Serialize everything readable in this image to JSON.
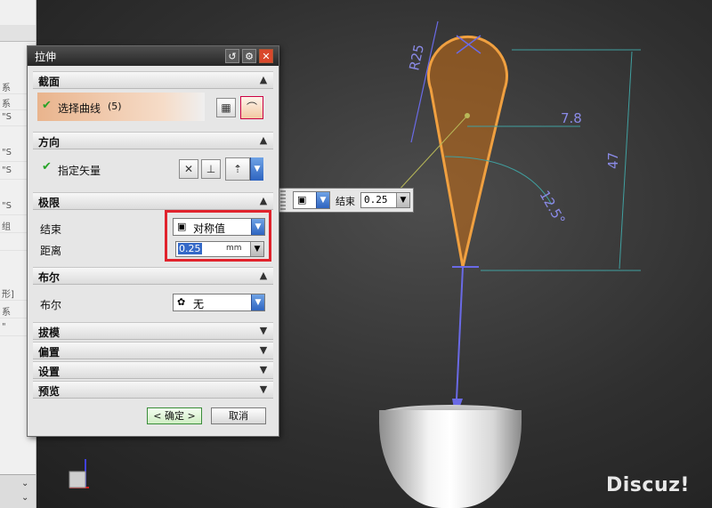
{
  "dialog": {
    "title": "拉伸",
    "title_icons": [
      "reset-icon",
      "gear-icon",
      "close-icon"
    ],
    "sections": {
      "section": {
        "header": "截面",
        "select_curve_label": "选择曲线",
        "select_curve_count": "(5)"
      },
      "direction": {
        "header": "方向",
        "specify_vector_label": "指定矢量"
      },
      "limits": {
        "header": "极限",
        "end_label": "结束",
        "end_value": "对称值",
        "distance_label": "距离",
        "distance_value": "0.25",
        "distance_unit": "mm"
      },
      "boolean": {
        "header": "布尔",
        "boolean_label": "布尔",
        "boolean_value": "无"
      },
      "draft": {
        "header": "拔模"
      },
      "offset": {
        "header": "偏置"
      },
      "settings": {
        "header": "设置"
      },
      "preview": {
        "header": "预览"
      }
    },
    "ok_label": "< 确定 >",
    "cancel_label": "取消"
  },
  "float_toolbar": {
    "end_label": "结束",
    "end_value": "0.25"
  },
  "sketch": {
    "radius_label": "R25",
    "dim_width": "7.8",
    "dim_height": "47",
    "dim_angle": "12.5°"
  },
  "left_panel": {
    "rows": [
      "系",
      "系",
      "\"S",
      "\"S",
      "\"S",
      "\"S",
      "组",
      "",
      "形]",
      "系",
      "\"",
      "",
      ""
    ]
  },
  "watermark": "Discuz!",
  "colors": {
    "accent_orange": "#f0a040",
    "dimension_blue": "#8a8ae6",
    "highlight_red": "#e0232d",
    "check_green": "#27a327"
  }
}
